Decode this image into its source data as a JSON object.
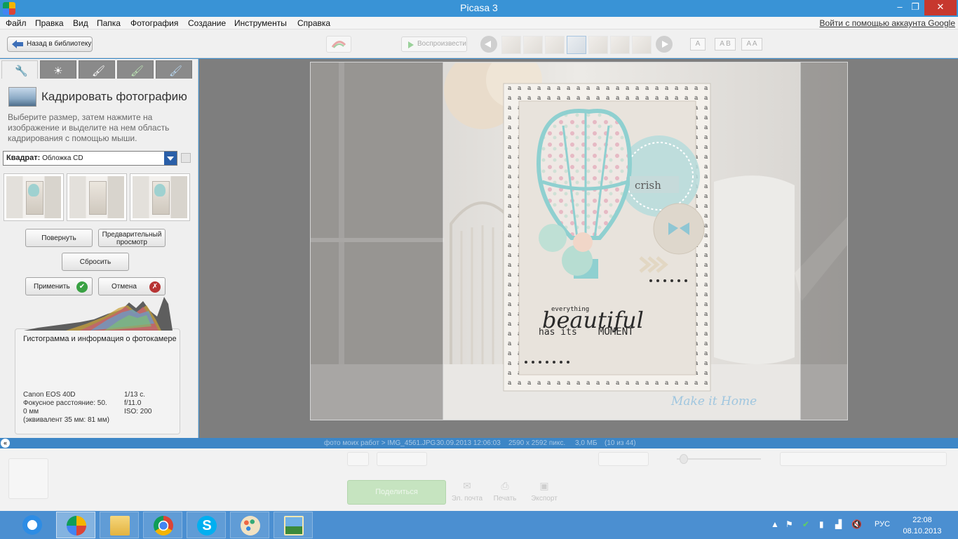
{
  "window": {
    "title": "Picasa 3",
    "minimize_glyph": "–",
    "maximize_glyph": "❐",
    "close_glyph": "✕"
  },
  "menu": {
    "items": [
      "Файл",
      "Правка",
      "Вид",
      "Папка",
      "Фотография",
      "Создание",
      "Инструменты",
      "Справка"
    ],
    "signin": "Войти с помощью аккаунта Google"
  },
  "toolbar": {
    "back_label": "Назад в библиотеку",
    "play_label": "Воспроизвести",
    "view_modes": [
      "A",
      "A B",
      "A A"
    ]
  },
  "left_panel": {
    "tab_icons": [
      "wrench-icon",
      "sun-icon",
      "brush-icon",
      "brush-green-icon",
      "brush-blue-icon"
    ],
    "crop_title": "Кадрировать фотографию",
    "instructions": "Выберите размер, затем нажмите на изображение и выделите на нем область кадрирования с помощью мыши.",
    "preset_bold": "Квадрат:",
    "preset_value": "Обложка CD",
    "buttons": {
      "rotate": "Повернуть",
      "preview": "Предварительный просмотр",
      "reset": "Сбросить",
      "apply": "Применить",
      "cancel": "Отмена"
    },
    "histogram": {
      "title": "Гистограмма и информация о фотокамере",
      "camera": "Canon EOS 40D",
      "focal": "Фокусное расстояние: 50.",
      "focal_cont": "0 мм",
      "equiv": "(эквивалент 35 мм:  81 мм)",
      "shutter": "1/13 с.",
      "aperture": "f/11.0",
      "iso": "ISO: 200"
    }
  },
  "photo": {
    "watermark": "Make it Home",
    "card_text": {
      "small": "everything",
      "big": "beautiful",
      "line": "has its",
      "moment": "MOMENT",
      "tag": "crish"
    }
  },
  "status": {
    "path": "фото моих работ > IMG_4561.JPG",
    "date": "30.09.2013 12:06:03",
    "dims": "2590 x 2592 пикс.",
    "size": "3,0 МБ",
    "count": "(10 из 44)"
  },
  "tray": {
    "share": "Поделиться",
    "email": "Эл. почта",
    "print": "Печать",
    "export": "Экспорт"
  },
  "taskbar": {
    "lang": "РУС",
    "time": "22:08",
    "date": "08.10.2013"
  }
}
